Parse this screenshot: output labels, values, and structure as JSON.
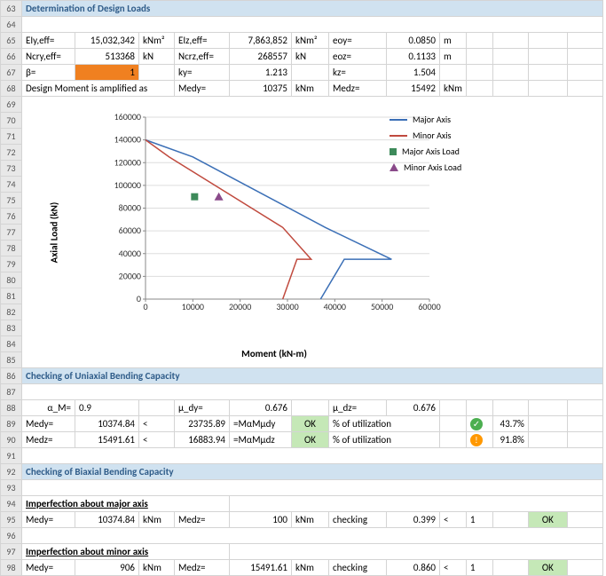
{
  "rows": {
    "63": {
      "title": "Determination of Design Loads"
    },
    "65": {
      "c1": "EIy,eff=",
      "c2": "15,032,342",
      "c3": "kNm²",
      "c4": "EIz,eff=",
      "c5": "7,863,852",
      "c6": "kNm²",
      "c7": "eoy=",
      "c8": "0.0850",
      "c9": "m"
    },
    "66": {
      "c1": "Ncry,eff=",
      "c2": "513368",
      "c3": "kN",
      "c4": "Ncrz,eff=",
      "c5": "268557",
      "c6": "kN",
      "c7": "eoz=",
      "c8": "0.1133",
      "c9": "m"
    },
    "67": {
      "c1": "β=",
      "c2": "1",
      "c4": "ky=",
      "c5": "1.213",
      "c7": "kz=",
      "c8": "1.504"
    },
    "68": {
      "c1": "Design Moment is amplified as",
      "c4": "Medy=",
      "c5": "10375",
      "c6": "kNm",
      "c7": "Medz=",
      "c8": "15492",
      "c9": "kNm"
    },
    "86": {
      "title": "Checking of Uniaxial Bending Capacity"
    },
    "88": {
      "c1": "α_M=",
      "c2": "0.9",
      "c4": "μ_dy=",
      "c5": "0.676",
      "c7": "μ_dz=",
      "c8": "0.676"
    },
    "89": {
      "c1": "Medy=",
      "c2": "10374.84",
      "c3": "<",
      "c4": "23735.89",
      "c5": "=MαMμdy",
      "c6": "OK",
      "c7": "% of utilization",
      "c8": "43.7%"
    },
    "90": {
      "c1": "Medz=",
      "c2": "15491.61",
      "c3": "<",
      "c4": "16883.94",
      "c5": "=MαMμdz",
      "c6": "OK",
      "c7": "% of utilization",
      "c8": "91.8%"
    },
    "92": {
      "title": "Checking of Biaxial Bending Capacity"
    },
    "94": {
      "sub": "Imperfection about major axis"
    },
    "95": {
      "c1": "Medy=",
      "c2": "10374.84",
      "c3": "kNm",
      "c4": "Medz=",
      "c5": "100",
      "c6": "kNm",
      "c7": "checking",
      "c8": "0.399",
      "c9": "<",
      "c10": "1",
      "c11": "OK"
    },
    "97": {
      "sub": "Imperfection about minor axis"
    },
    "98": {
      "c1": "Medy=",
      "c2": "906",
      "c3": "kNm",
      "c4": "Medz=",
      "c5": "15491.61",
      "c6": "kNm",
      "c7": "checking",
      "c8": "0.860",
      "c9": "<",
      "c10": "1",
      "c11": "OK"
    }
  },
  "chart_data": {
    "type": "line",
    "xlabel": "Moment (kN-m)",
    "ylabel": "Axial Load (kN)",
    "xlim": [
      0,
      60000
    ],
    "ylim": [
      0,
      160000
    ],
    "xticks": [
      0,
      10000,
      20000,
      30000,
      40000,
      50000,
      60000
    ],
    "yticks": [
      0,
      20000,
      40000,
      60000,
      80000,
      100000,
      120000,
      140000,
      160000
    ],
    "series": [
      {
        "name": "Major Axis",
        "type": "line",
        "color": "#3b6fb6",
        "points": [
          [
            0,
            140000
          ],
          [
            10000,
            125000
          ],
          [
            38000,
            63000
          ],
          [
            52000,
            35000
          ],
          [
            42000,
            35000
          ],
          [
            37000,
            0
          ]
        ]
      },
      {
        "name": "Minor Axis",
        "type": "line",
        "color": "#c04a3e",
        "points": [
          [
            0,
            140000
          ],
          [
            5000,
            125000
          ],
          [
            29000,
            63000
          ],
          [
            35000,
            35000
          ],
          [
            32000,
            35000
          ],
          [
            29000,
            0
          ]
        ]
      },
      {
        "name": "Major Axis Load",
        "type": "scatter",
        "shape": "square",
        "color": "#3d8a5a",
        "points": [
          [
            10375,
            90000
          ]
        ]
      },
      {
        "name": "Minor Axis Load",
        "type": "scatter",
        "shape": "triangle",
        "color": "#8a4a8a",
        "points": [
          [
            15492,
            90000
          ]
        ]
      }
    ],
    "legend_position": "top-right"
  }
}
